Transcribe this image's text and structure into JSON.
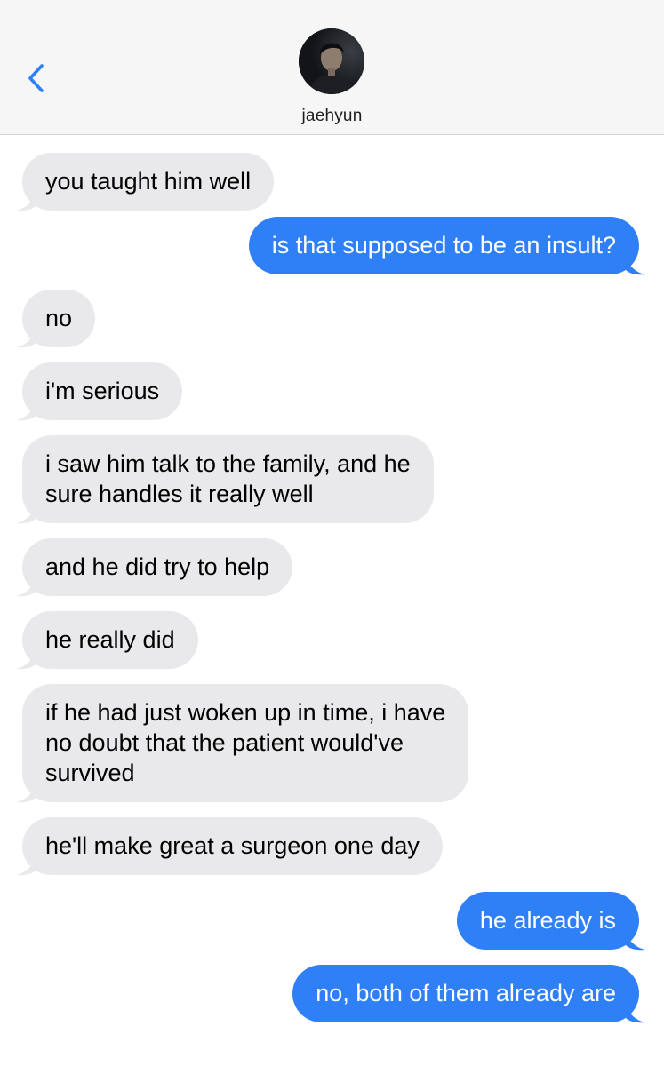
{
  "header": {
    "contact_name": "jaehyun",
    "back_icon": "chevron-left-icon"
  },
  "colors": {
    "accent": "#2f80f6",
    "incoming_bubble": "#e9e9eb",
    "header_bg": "#f6f6f6"
  },
  "messages": [
    {
      "from": "them",
      "text": "you taught him well"
    },
    {
      "from": "me",
      "text": "is that supposed to be an insult?"
    },
    {
      "from": "them",
      "text": "no"
    },
    {
      "from": "them",
      "text": "i'm serious"
    },
    {
      "from": "them",
      "lines": [
        "i saw him talk to the family, and he",
        "sure handles it really well"
      ]
    },
    {
      "from": "them",
      "text": "and he did try to help"
    },
    {
      "from": "them",
      "text": "he really did"
    },
    {
      "from": "them",
      "lines": [
        "if he had just woken up in time, i have",
        "no doubt that the patient would've",
        "survived"
      ]
    },
    {
      "from": "them",
      "text": "he'll make great a surgeon one day"
    },
    {
      "from": "me",
      "text": "he already is"
    },
    {
      "from": "me",
      "text": "no, both of them already are"
    }
  ]
}
